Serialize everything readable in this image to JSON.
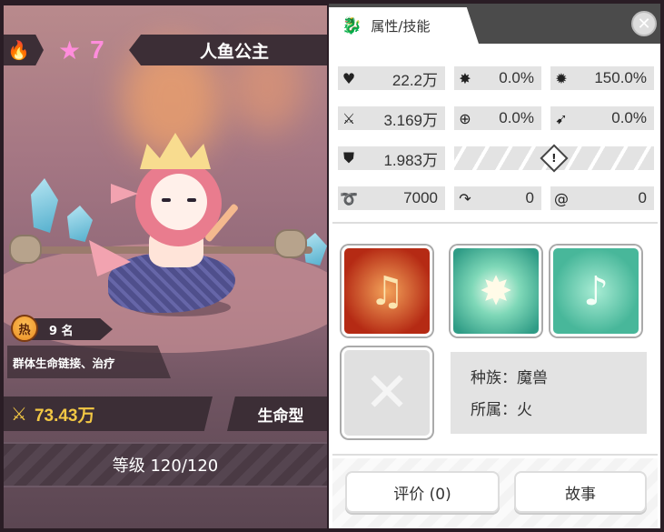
{
  "hero": {
    "stars": "7",
    "name": "人鱼公主",
    "hot_badge": "热",
    "hot_rank": "9 名",
    "description": "群体生命链接、治疗",
    "power": "73.43万",
    "type": "生命型",
    "level": "等级 120/120"
  },
  "tab": {
    "label": "属性/技能",
    "icon": "dragon-icon"
  },
  "stats": {
    "hp": "22.2万",
    "crit_rate": "0.0%",
    "crit_damage": "150.0%",
    "attack": "3.169万",
    "accuracy": "0.0%",
    "dodge": "0.0%",
    "defense": "1.983万",
    "speed": "7000",
    "stat_a": "0",
    "stat_b": "0"
  },
  "info": {
    "race": "种族：魔兽",
    "faction": "所属：火"
  },
  "buttons": {
    "review": "评价 (0)",
    "story": "故事"
  },
  "colors": {
    "star": "#ff8ddc",
    "power": "#f2c744",
    "dark_bar": "#3c2e36",
    "stat_bg": "#e3e3e3"
  }
}
